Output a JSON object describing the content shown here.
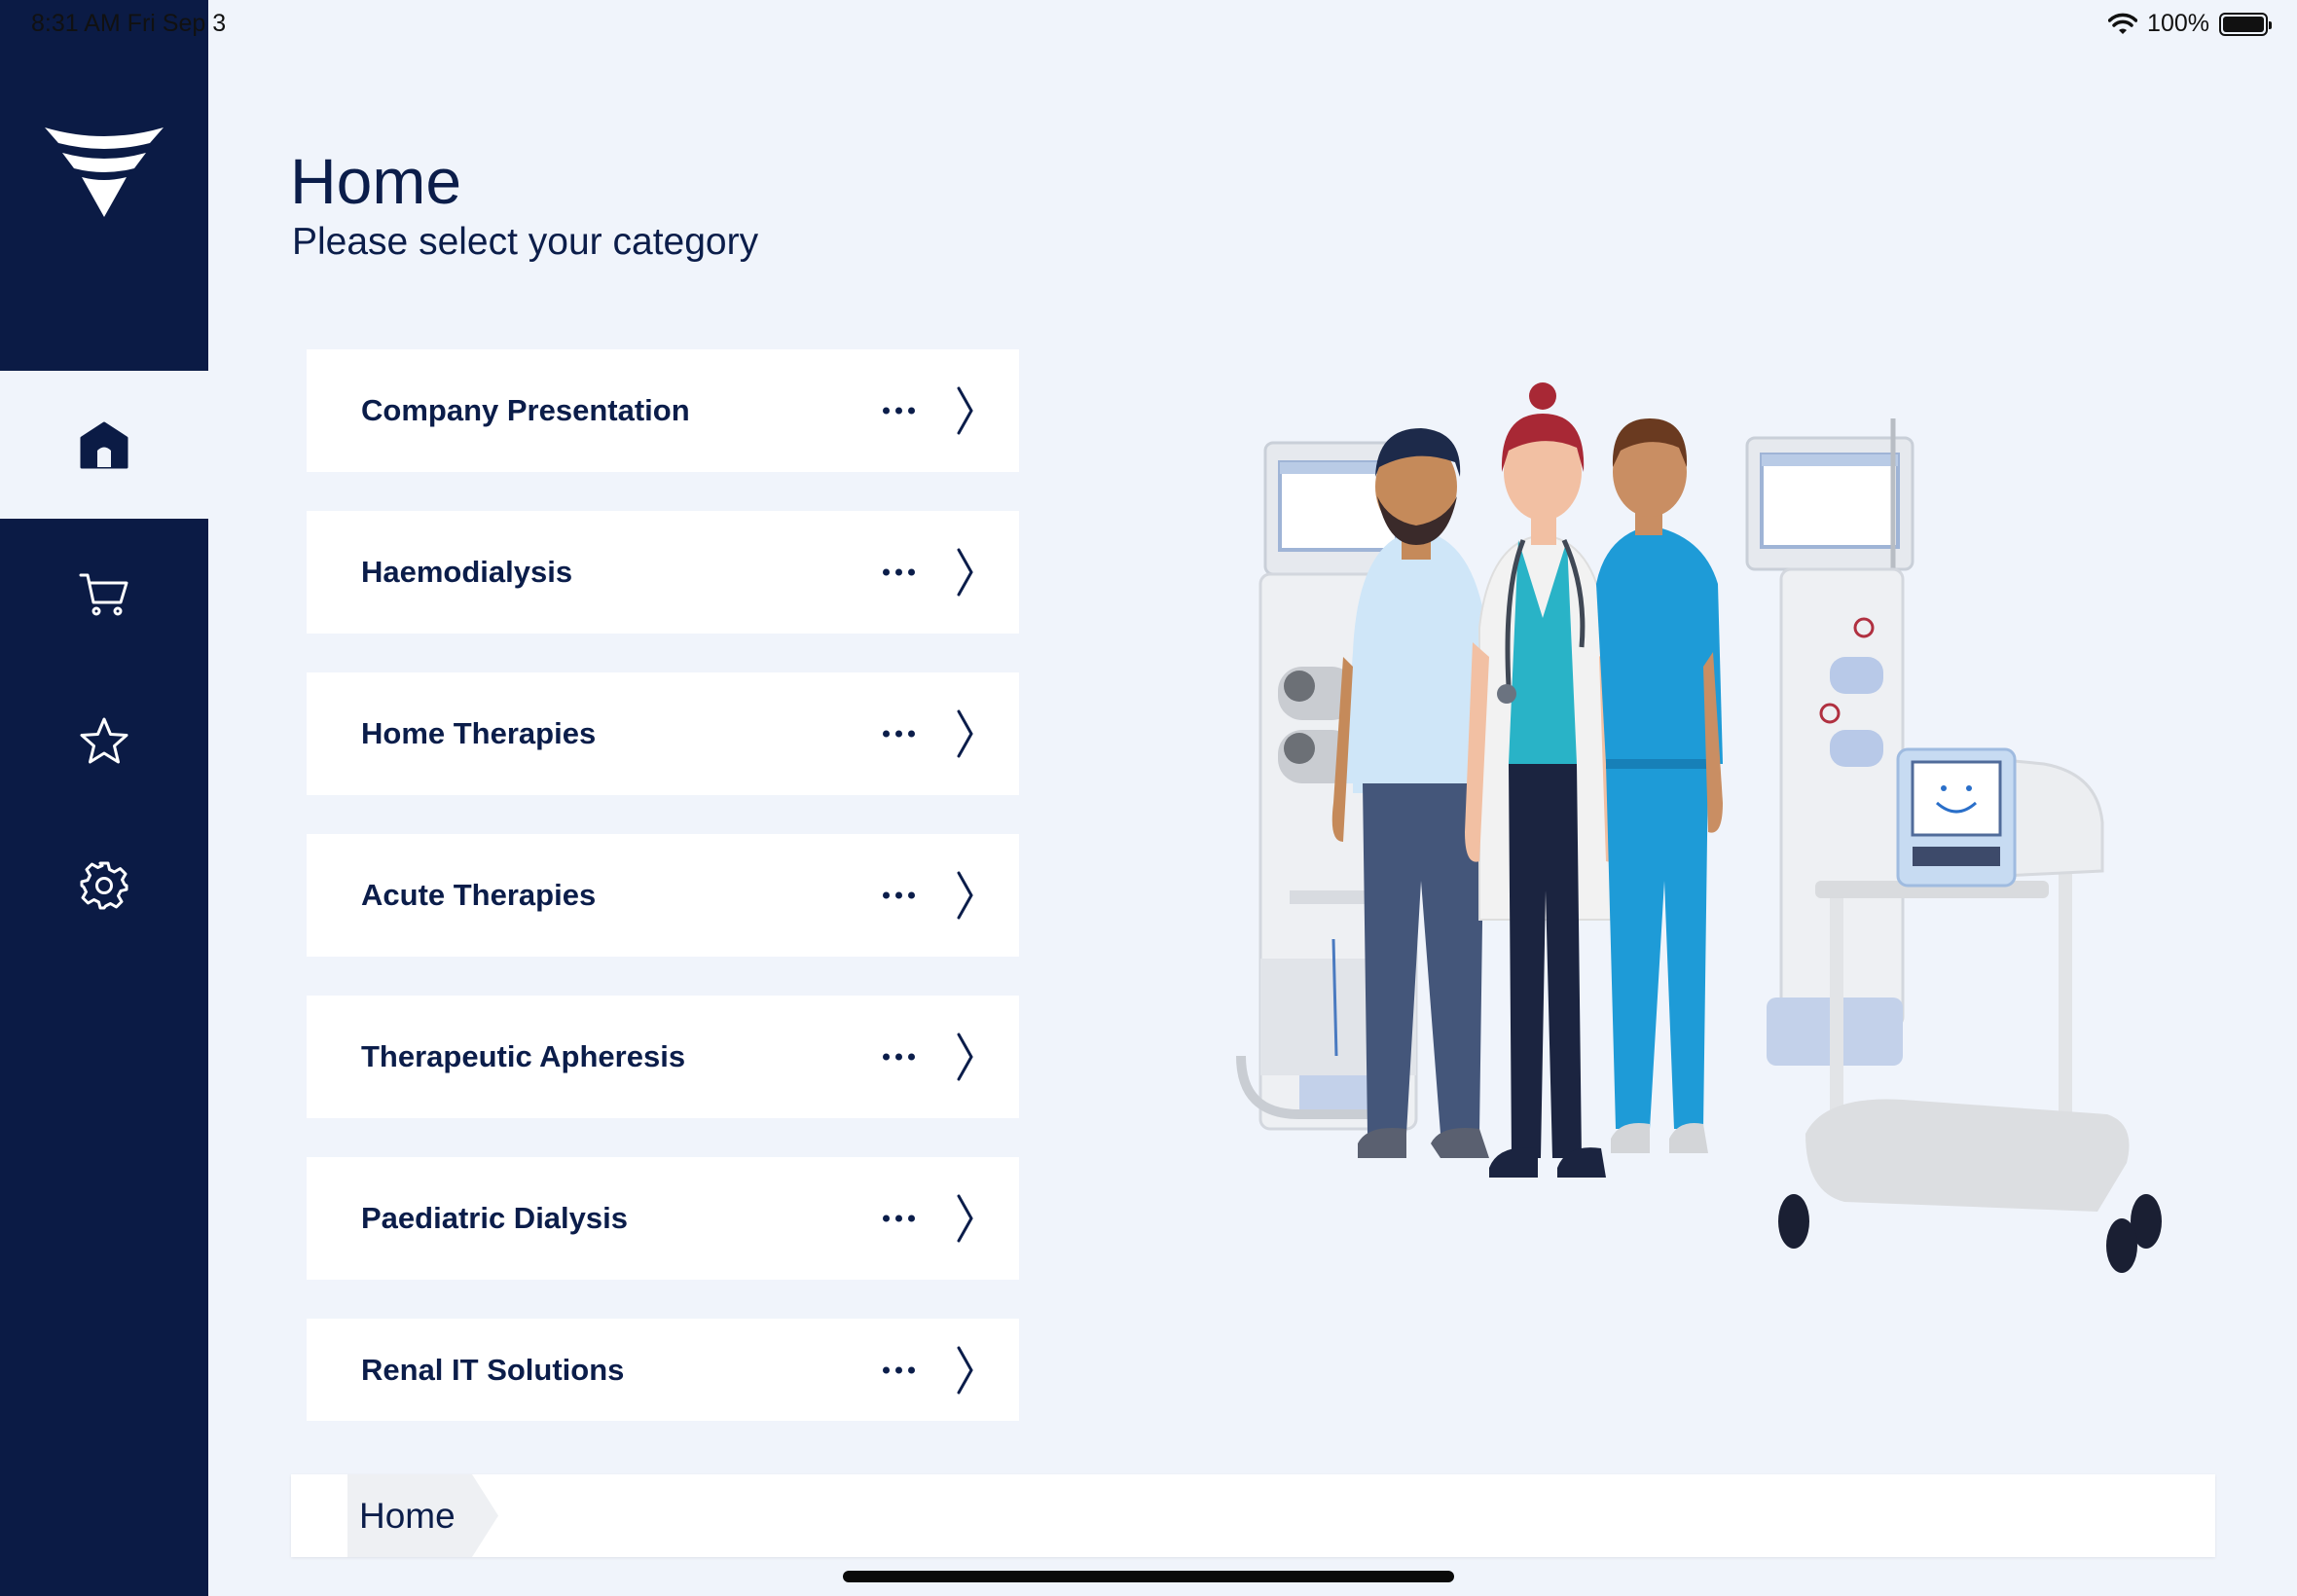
{
  "status_bar": {
    "time": "8:31 AM   Fri Sep 3",
    "battery": "100%",
    "battery_level": 1.0
  },
  "sidebar": {
    "items": [
      {
        "name": "home",
        "icon": "home-icon",
        "active": true
      },
      {
        "name": "cart",
        "icon": "cart-icon",
        "active": false
      },
      {
        "name": "favorites",
        "icon": "star-icon",
        "active": false
      },
      {
        "name": "settings",
        "icon": "gear-icon",
        "active": false
      }
    ]
  },
  "header": {
    "title": "Home",
    "subtitle": "Please select your category"
  },
  "categories": [
    {
      "label": "Company Presentation"
    },
    {
      "label": "Haemodialysis"
    },
    {
      "label": "Home Therapies"
    },
    {
      "label": "Acute Therapies"
    },
    {
      "label": "Therapeutic Apheresis"
    },
    {
      "label": "Paediatric Dialysis"
    },
    {
      "label": "Renal IT Solutions"
    }
  ],
  "breadcrumb": {
    "items": [
      "Home"
    ]
  },
  "colors": {
    "navy": "#0b1b45",
    "background": "#f0f4fb",
    "card": "#ffffff",
    "text": "#0b1d4a"
  }
}
